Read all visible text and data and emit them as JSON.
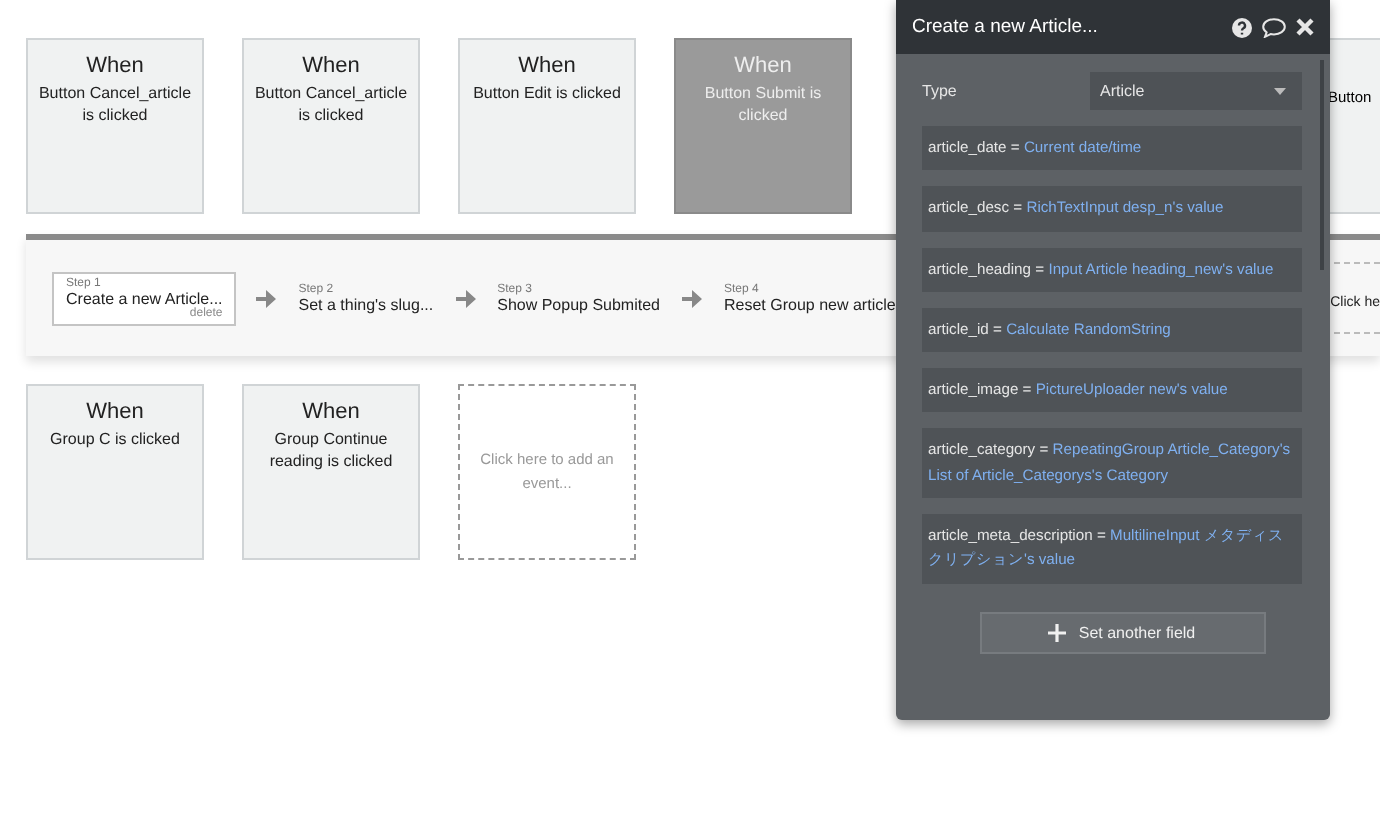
{
  "event_rows": [
    {
      "events": [
        {
          "kind": "event",
          "heading": "When",
          "trigger": "Button Cancel_article is clicked",
          "selected": false
        },
        {
          "kind": "event",
          "heading": "When",
          "trigger": "Button Cancel_article is clicked",
          "selected": false
        },
        {
          "kind": "event",
          "heading": "When",
          "trigger": "Button Edit is clicked",
          "selected": false
        },
        {
          "kind": "event",
          "heading": "When",
          "trigger": "Button Submit is clicked",
          "selected": true
        },
        {
          "kind": "hidden"
        },
        {
          "kind": "hidden"
        },
        {
          "kind": "cut",
          "trigger": "Button"
        }
      ]
    },
    {
      "events": [
        {
          "kind": "event",
          "heading": "When",
          "trigger": "Group C is clicked",
          "selected": false
        },
        {
          "kind": "event",
          "heading": "When",
          "trigger": "Group Continue reading is clicked",
          "selected": false
        },
        {
          "kind": "add",
          "trigger": "Click here to add an event..."
        }
      ]
    }
  ],
  "steps": [
    {
      "kind": "step",
      "label": "Step 1",
      "action": "Create a new Article...",
      "delete": "delete",
      "selected": true
    },
    {
      "kind": "step",
      "label": "Step 2",
      "action": "Set a thing's slug...",
      "selected": false
    },
    {
      "kind": "step",
      "label": "Step 3",
      "action": "Show Popup Submited",
      "selected": false
    },
    {
      "kind": "step",
      "label": "Step 4",
      "action": "Reset Group new article",
      "selected": false
    },
    {
      "kind": "cut",
      "action": "Click he"
    }
  ],
  "panel": {
    "title": "Create a new Article...",
    "type_label": "Type",
    "type_value": "Article",
    "fields": [
      {
        "name": "article_date",
        "equals": "=",
        "value": "Current date/time"
      },
      {
        "name": "article_desc",
        "equals": "=",
        "value": "RichTextInput desp_n's value"
      },
      {
        "name": "article_heading",
        "equals": "=",
        "value": "Input Article heading_new's value"
      },
      {
        "name": "article_id",
        "equals": "=",
        "value": "Calculate RandomString"
      },
      {
        "name": "article_image",
        "equals": "=",
        "value": "PictureUploader new's value"
      },
      {
        "name": "article_category",
        "equals": "=",
        "value": "RepeatingGroup Article_Category's List of Article_Categorys's Category"
      },
      {
        "name": "article_meta_description",
        "equals": "=",
        "value": "MultilineInput メタディスクリプション's value"
      }
    ],
    "add_button": "Set another field"
  }
}
